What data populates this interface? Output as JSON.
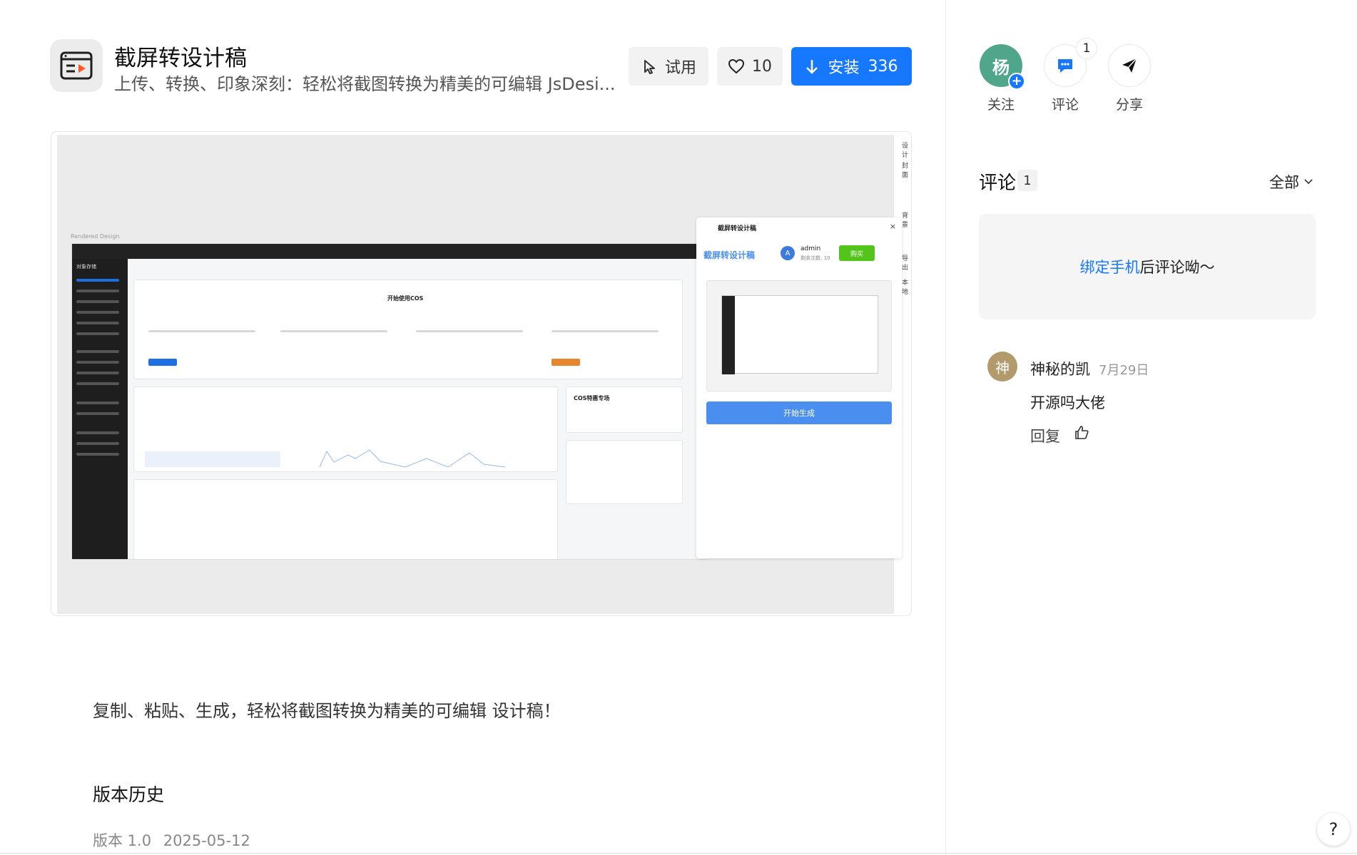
{
  "plugin": {
    "title": "截屏转设计稿",
    "subtitle": "上传、转换、印象深刻：轻松将截图转换为精美的可编辑 JsDesi...",
    "try_label": "试用",
    "like_count": "10",
    "install_label": "安装",
    "install_count": "336",
    "description": "复制、粘贴、生成，轻松将截图转换为精美的可编辑 设计稿！",
    "version_history_title": "版本历史",
    "version_label": "版本 1.0",
    "version_date": "2025-05-12"
  },
  "preview": {
    "rendered_label": "Rendered Design",
    "side_labels": [
      "设计",
      "封面",
      "背景",
      "导出",
      "本地"
    ],
    "panel_title": "截屏转设计稿",
    "panel_brand": "截屏转设计稿",
    "panel_user": "admin",
    "panel_user_initial": "A",
    "panel_remaining": "剩余次数: 10",
    "panel_buy": "购买",
    "panel_generate": "开始生成",
    "inner_heading": "开始使用COS",
    "inner_sidebar_title": "对象存储",
    "inner_promo": "COS特惠专场"
  },
  "actions": {
    "follow_avatar": "杨",
    "follow_label": "关注",
    "comment_label": "评论",
    "comment_badge": "1",
    "share_label": "分享"
  },
  "comments": {
    "title": "评论",
    "count": "1",
    "filter_label": "全部",
    "bind_link": "绑定手机",
    "bind_suffix": " 后评论呦～",
    "items": [
      {
        "avatar": "神",
        "name": "神秘的凯",
        "date": "7月29日",
        "text": "开源吗大佬",
        "reply_label": "回复"
      }
    ]
  },
  "help_label": "?",
  "colors": {
    "primary": "#1677ff",
    "follow_avatar": "#4fa68a",
    "commenter_avatar": "#b39a6b",
    "buy_green": "#52c41a",
    "panel_button": "#4a8ff0"
  }
}
